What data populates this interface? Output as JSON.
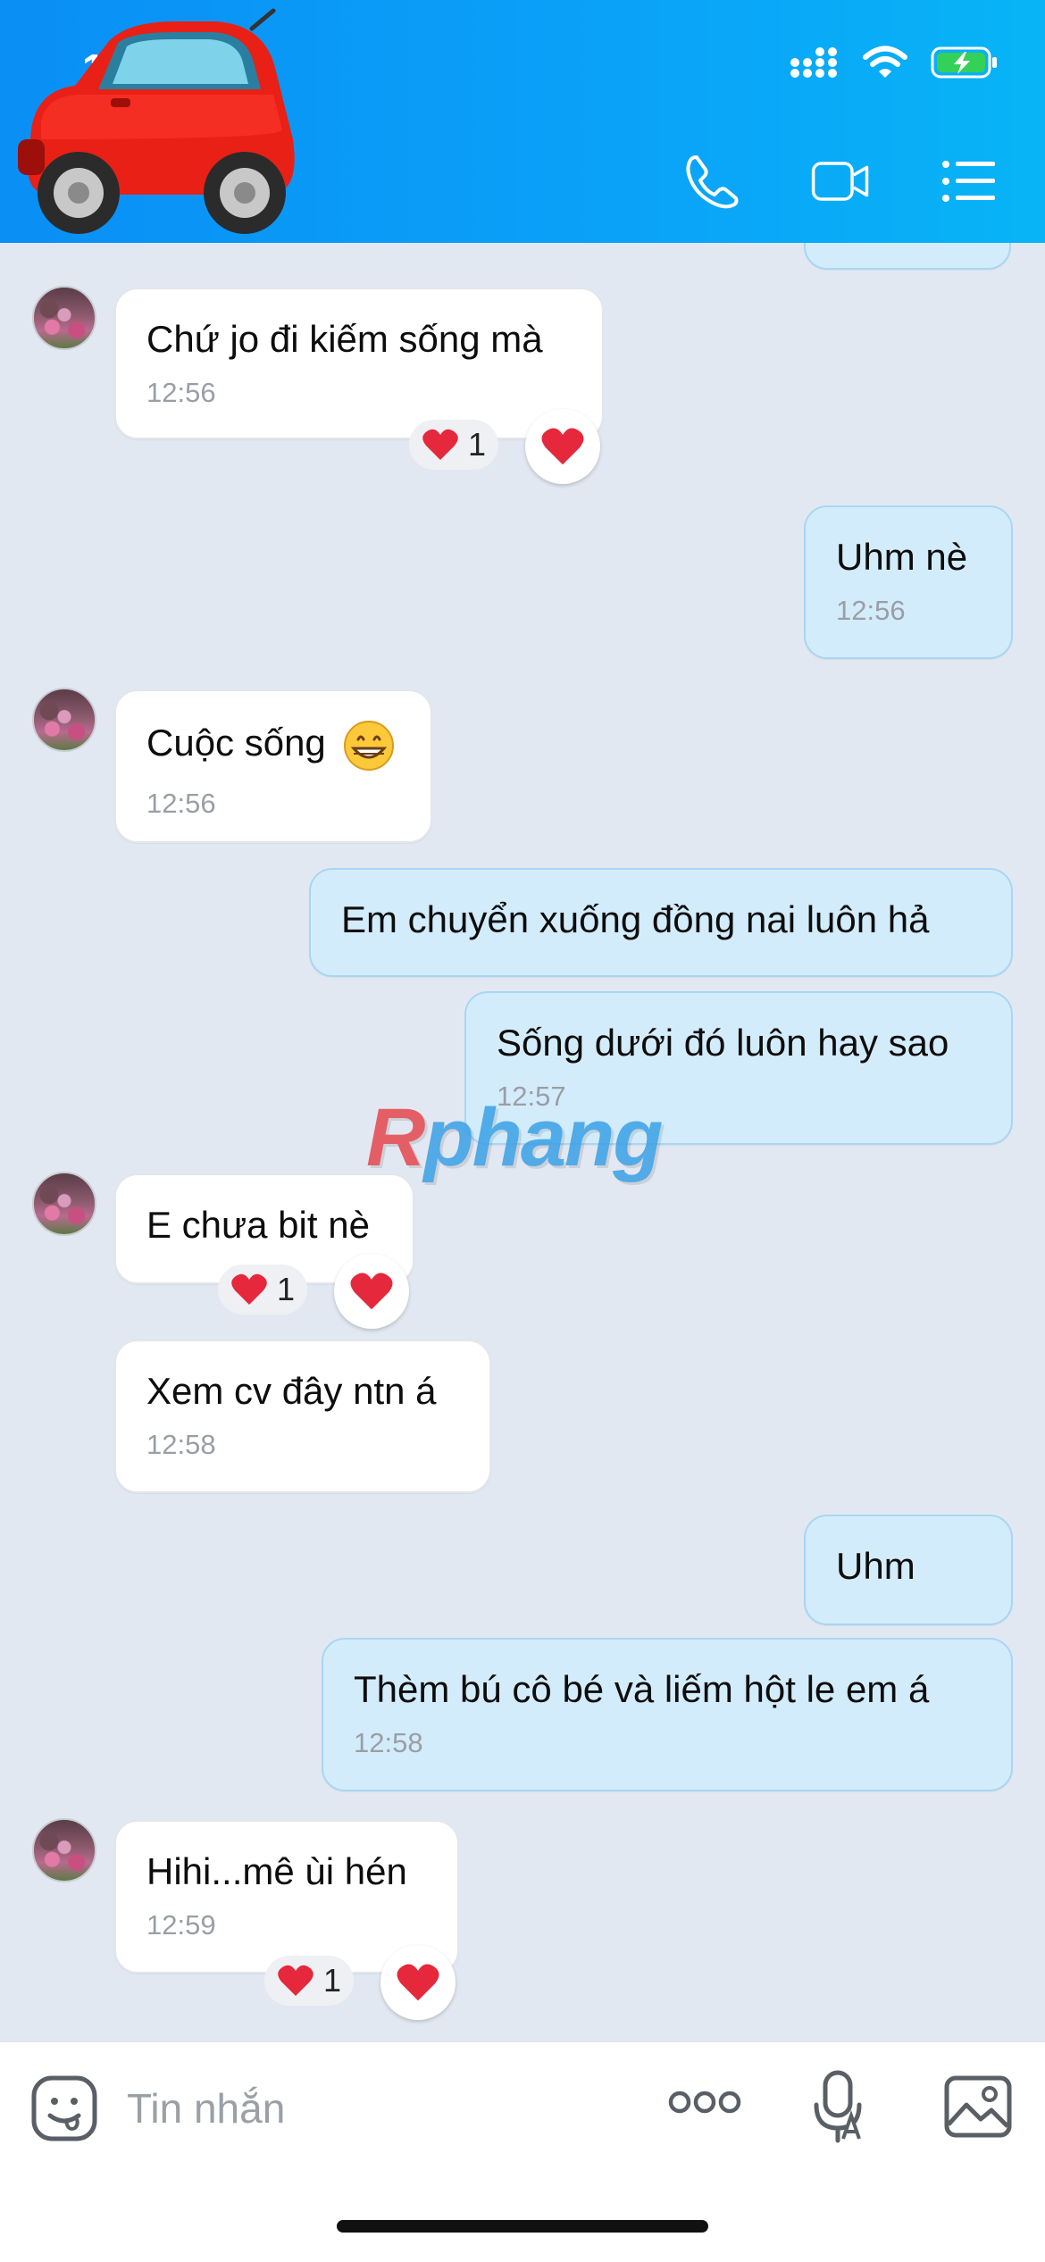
{
  "status_bar": {
    "time": "1"
  },
  "composer": {
    "placeholder": "Tin nhắn"
  },
  "watermark": {
    "r": "R",
    "rest": "phang"
  },
  "messages": [
    {
      "text": "Chứ jo đi kiếm sống mà",
      "time": "12:56",
      "reactions": "1"
    },
    {
      "text": "Uhm nè",
      "time": "12:56"
    },
    {
      "text": "Cuộc sống",
      "time": "12:56"
    },
    {
      "text": "Em chuyển xuống đồng nai luôn hả"
    },
    {
      "text": "Sống dưới đó luôn hay sao",
      "time": "12:57"
    },
    {
      "text": "E chưa bit nè",
      "reactions": "1"
    },
    {
      "text": "Xem cv đây ntn á",
      "time": "12:58"
    },
    {
      "text": "Uhm"
    },
    {
      "text": "Thèm bú cô bé và liếm hột le em á",
      "time": "12:58"
    },
    {
      "text": "Hihi...mê ùi hén",
      "time": "12:59",
      "reactions": "1"
    }
  ],
  "colors": {
    "header_gradient_start": "#0a8ff5",
    "header_gradient_end": "#08b4f6",
    "chat_background": "#e2e8f1",
    "incoming_bubble": "#ffffff",
    "outgoing_bubble": "#d3ecfb",
    "heart": "#e5283b"
  },
  "icons": [
    "car-emoji-icon",
    "signal-icon",
    "wifi-icon",
    "battery-charging-icon",
    "phone-icon",
    "video-call-icon",
    "menu-list-icon",
    "heart-icon",
    "grinning-face-icon",
    "sticker-icon",
    "more-icon",
    "microphone-icon",
    "image-icon"
  ]
}
